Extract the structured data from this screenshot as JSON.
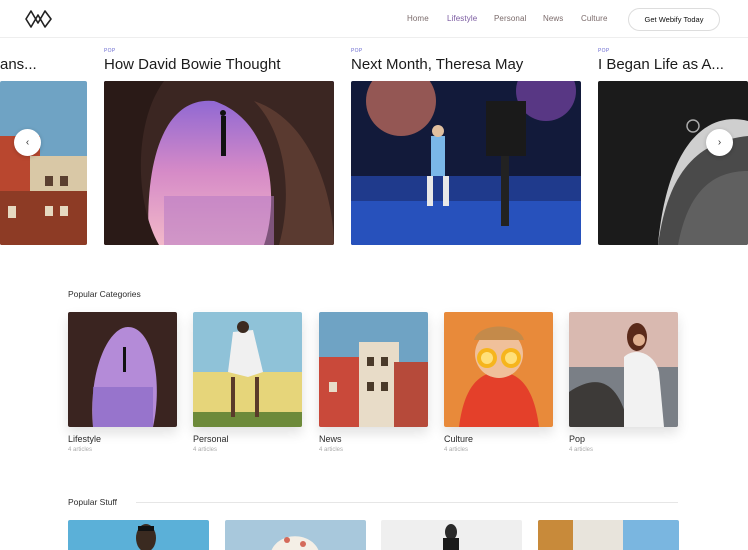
{
  "header": {
    "nav": [
      {
        "label": "Home",
        "color": "#7a6a6a"
      },
      {
        "label": "Lifestyle",
        "color": "#7a5aa0"
      },
      {
        "label": "Personal",
        "color": "#7a6a6a"
      },
      {
        "label": "News",
        "color": "#7a6a6a"
      },
      {
        "label": "Culture",
        "color": "#7a6a6a"
      }
    ],
    "cta_label": "Get Webify Today"
  },
  "carousel": {
    "slides": [
      {
        "tag": "",
        "title": "ans..."
      },
      {
        "tag": "POP",
        "title": "How David Bowie Thought"
      },
      {
        "tag": "POP",
        "title": "Next Month, Theresa May"
      },
      {
        "tag": "POP",
        "title": "I Began Life as A..."
      }
    ],
    "prev_icon": "chevron-left-icon",
    "next_icon": "chevron-right-icon"
  },
  "popular_categories": {
    "title": "Popular Categories",
    "items": [
      {
        "name": "Lifestyle",
        "count": "4 articles"
      },
      {
        "name": "Personal",
        "count": "4 articles"
      },
      {
        "name": "News",
        "count": "4 articles"
      },
      {
        "name": "Culture",
        "count": "4 articles"
      },
      {
        "name": "Pop",
        "count": "4 articles"
      }
    ]
  },
  "popular_stuff": {
    "title": "Popular Stuff"
  },
  "colors": {
    "accent": "#6b6bd0",
    "nav_active": "#7a5aa0"
  }
}
